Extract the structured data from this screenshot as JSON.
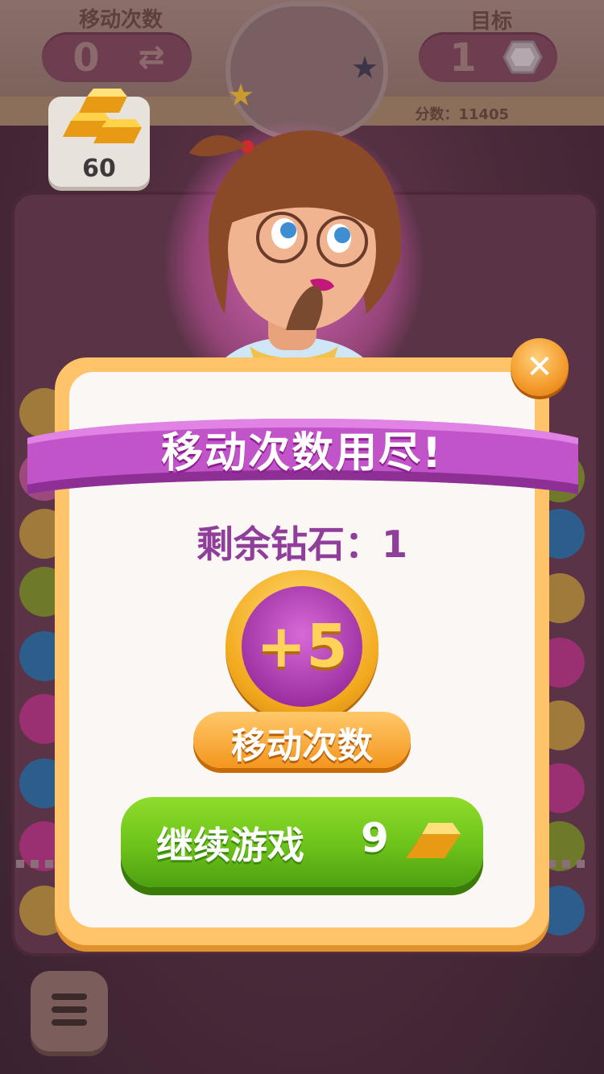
{
  "hud": {
    "moves_label": "移动次数",
    "moves_value": "0",
    "goal_label": "目标",
    "goal_value": "1",
    "score_text": "分数：11405",
    "gold_count": "60"
  },
  "dialog": {
    "title": "移动次数用尽!",
    "remaining_text": "剩余钻石：1",
    "bonus_amount": "+5",
    "bonus_label": "移动次数",
    "continue_label": "继续游戏",
    "continue_cost": "9"
  },
  "icons": {
    "close": "close-icon",
    "gold": "gold-bars-icon",
    "gem": "diamond-icon",
    "swap": "swap-arrows-icon",
    "menu": "menu-icon"
  },
  "colors": {
    "title_ribbon": "#c154c8",
    "accent_purple": "#8f3f9a",
    "continue_green": "#6cc21a",
    "orange": "#f3961e"
  }
}
